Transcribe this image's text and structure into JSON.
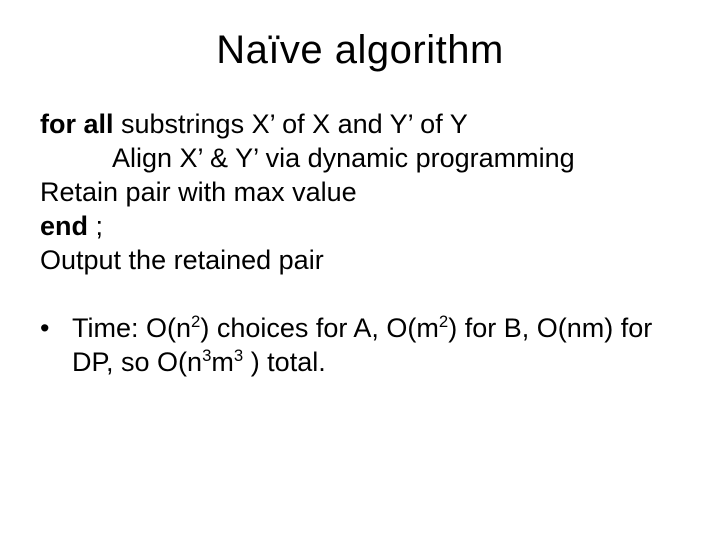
{
  "title": "Naïve algorithm",
  "body": {
    "line1_a": "for all",
    "line1_b": " substrings X’ of X and Y’ of Y",
    "line2": "Align X’ & Y’ via dynamic programming",
    "line3": "Retain pair with max value",
    "line4_a": "end",
    "line4_b": " ;",
    "line5": "Output the retained pair"
  },
  "bullet": {
    "dot": "•",
    "t1": "Time: O(n",
    "t2": "2",
    "t3": ") choices for A, O(m",
    "t4": "2",
    "t5": ") for B, O(nm) for DP, so O(n",
    "t6": "3",
    "t7": "m",
    "t8": "3",
    "t9": " ) total."
  }
}
